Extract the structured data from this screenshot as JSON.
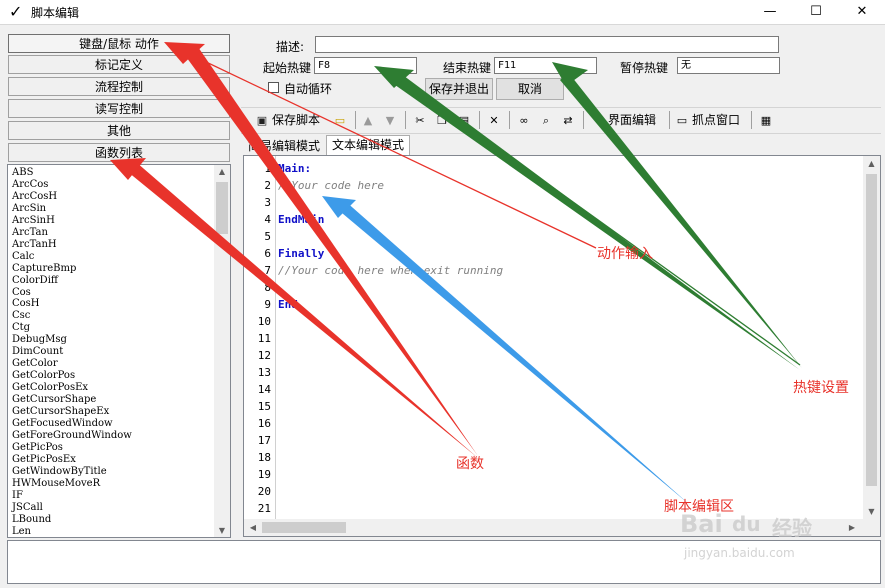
{
  "window": {
    "title": "脚本编辑",
    "check_glyph": "✓",
    "controls": {
      "minimize": "—",
      "maximize": "☐",
      "close": "✕"
    }
  },
  "categories": [
    "键盘/鼠标 动作",
    "标记定义",
    "流程控制",
    "读写控制",
    "其他",
    "函数列表"
  ],
  "functions": [
    "ABS",
    "ArcCos",
    "ArcCosH",
    "ArcSin",
    "ArcSinH",
    "ArcTan",
    "ArcTanH",
    "Calc",
    "CaptureBmp",
    "ColorDiff",
    "Cos",
    "CosH",
    "Csc",
    "Ctg",
    "DebugMsg",
    "DimCount",
    "GetColor",
    "GetColorPos",
    "GetColorPosEx",
    "GetCursorShape",
    "GetCursorShapeEx",
    "GetFocusedWindow",
    "GetForeGroundWindow",
    "GetPicPos",
    "GetPicPosEx",
    "GetWindowByTitle",
    "HWMouseMoveR",
    "IF",
    "JSCall",
    "LBound",
    "Len"
  ],
  "form": {
    "desc_label": "描述:",
    "desc_value": "",
    "start_hotkey_label": "起始热键",
    "start_hotkey_value": "F8",
    "end_hotkey_label": "结束热键",
    "end_hotkey_value": "F11",
    "pause_hotkey_label": "暂停热键",
    "pause_hotkey_value": "无",
    "auto_loop_label": "自动循环",
    "save_exit_label": "保存并退出",
    "cancel_label": "取消"
  },
  "toolbar": {
    "save_script": "保存脚本",
    "ui_edit": "界面编辑",
    "capture_window": "抓点窗口"
  },
  "tabs": [
    "简易编辑模式",
    "文本编辑模式"
  ],
  "editor": {
    "line_numbers": [
      "1",
      "2",
      "3",
      "4",
      "5",
      "6",
      "7",
      "8",
      "9",
      "10",
      "11",
      "12",
      "13",
      "14",
      "15",
      "16",
      "17",
      "18",
      "19",
      "20",
      "21"
    ],
    "lines": [
      {
        "text": "Main:",
        "style": "kw"
      },
      {
        "text": "//Your code here",
        "style": "cm"
      },
      {
        "text": "",
        "style": "plain"
      },
      {
        "text": "EndMain",
        "style": "kw"
      },
      {
        "text": "",
        "style": "plain"
      },
      {
        "text": "Finally",
        "style": "kw"
      },
      {
        "text": "//Your code here when exit running",
        "style": "cm"
      },
      {
        "text": "",
        "style": "plain"
      },
      {
        "text": "End",
        "style": "kw"
      }
    ]
  },
  "annotations": {
    "action_input": "动作输入",
    "hotkey_settings": "热键设置",
    "functions": "函数",
    "script_area": "脚本编辑区"
  },
  "watermark": {
    "brand": "Bai",
    "paw": "du",
    "product": "经验",
    "url": "jingyan.baidu.com"
  },
  "colors": {
    "red_arrow": "#e8332b",
    "green_arrow": "#2e7d32",
    "blue_arrow": "#3d9be9",
    "keyword": "#1010c8",
    "comment": "#808080"
  }
}
